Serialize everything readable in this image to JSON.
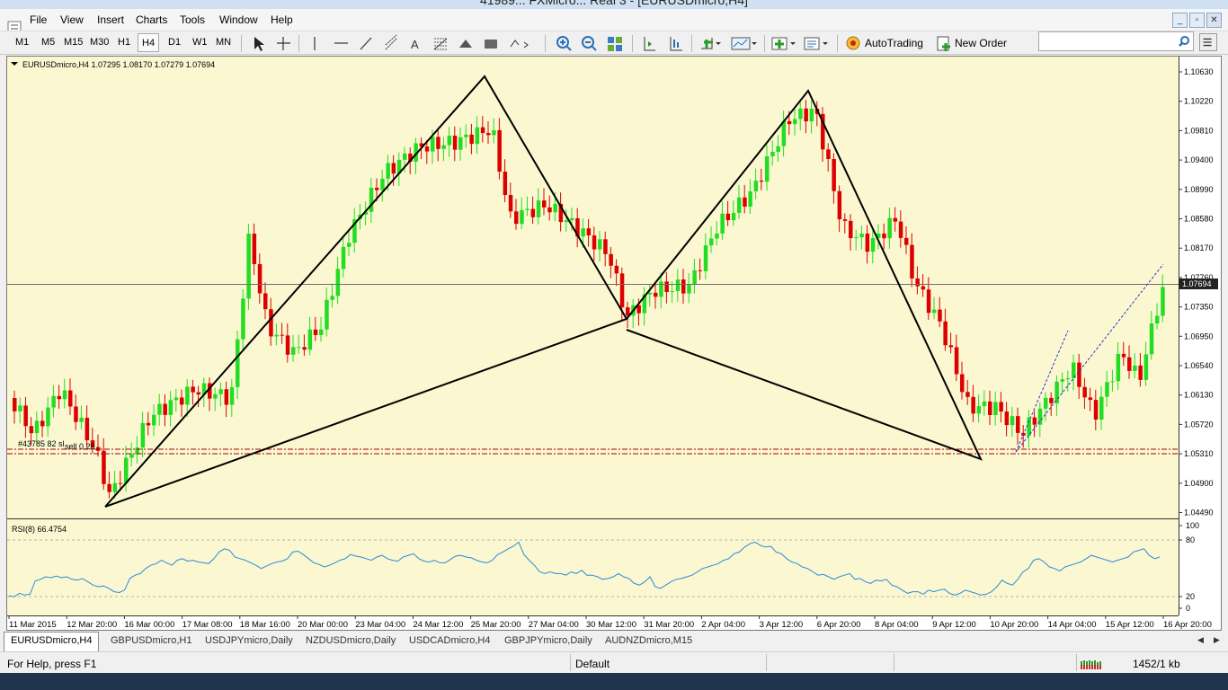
{
  "window": {
    "title": "41989... FXMicro... Real 3 - [EURUSDmicro,H4]"
  },
  "menu": {
    "items": [
      "File",
      "View",
      "Insert",
      "Charts",
      "Tools",
      "Window",
      "Help"
    ]
  },
  "toolbar": {
    "timeframes": [
      "M1",
      "M5",
      "M15",
      "M30",
      "H1",
      "H4",
      "D1",
      "W1",
      "MN"
    ],
    "active_timeframe": "H4",
    "autotrading_label": "AutoTrading",
    "new_order_label": "New Order",
    "search_placeholder": ""
  },
  "chart": {
    "header": "EURUSDmicro,H4  1.07295 1.08170 1.07279 1.07694",
    "current_price_label": "1.07694",
    "price_labels": [
      "1.10630",
      "1.10220",
      "1.09810",
      "1.09400",
      "1.08990",
      "1.08580",
      "1.08170",
      "1.07760",
      "1.07350",
      "1.06950",
      "1.06540",
      "1.06130",
      "1.05720",
      "1.05310",
      "1.04900",
      "1.04490"
    ],
    "order_label": "#43785 82 sl",
    "order_label_2": "sell 0.26",
    "time_labels": [
      "11 Mar 2015",
      "12 Mar 20:00",
      "16 Mar 00:00",
      "17 Mar 08:00",
      "18 Mar 16:00",
      "20 Mar 00:00",
      "23 Mar 04:00",
      "24 Mar 12:00",
      "25 Mar 20:00",
      "27 Mar 04:00",
      "30 Mar 12:00",
      "31 Mar 20:00",
      "2 Apr 04:00",
      "3 Apr 12:00",
      "6 Apr 20:00",
      "8 Apr 04:00",
      "9 Apr 12:00",
      "10 Apr 20:00",
      "14 Apr 04:00",
      "15 Apr 12:00",
      "16 Apr 20:00"
    ],
    "colors": {
      "background": "#fbf8d1",
      "bull": "#22dd22",
      "bear": "#dd0000",
      "pattern": "#000000",
      "rsi": "#2a8ad8",
      "order_line": "#a40000"
    }
  },
  "rsi": {
    "header": "RSI(8) 66.4754",
    "levels": [
      "100",
      "80",
      "20",
      "0"
    ],
    "values": [
      15,
      14,
      18,
      16,
      17,
      33,
      35,
      38,
      37,
      39,
      37,
      38,
      35,
      34,
      36,
      32,
      28,
      26,
      27,
      24,
      20,
      19,
      22,
      36,
      40,
      42,
      48,
      52,
      54,
      58,
      55,
      52,
      58,
      60,
      57,
      58,
      56,
      55,
      54,
      60,
      68,
      72,
      70,
      62,
      60,
      58,
      55,
      52,
      48,
      51,
      54,
      56,
      57,
      60,
      68,
      69,
      65,
      60,
      55,
      53,
      50,
      52,
      55,
      58,
      60,
      65,
      63,
      62,
      60,
      58,
      62,
      64,
      60,
      58,
      57,
      62,
      64,
      66,
      60,
      57,
      56,
      58,
      55,
      55,
      59,
      63,
      64,
      62,
      61,
      58,
      56,
      55,
      58,
      65,
      68,
      72,
      75,
      80,
      65,
      58,
      52,
      44,
      42,
      44,
      42,
      42,
      40,
      44,
      42,
      46,
      40,
      40,
      38,
      35,
      36,
      38,
      42,
      38,
      36,
      30,
      28,
      32,
      38,
      26,
      24,
      28,
      32,
      35,
      36,
      38,
      40,
      44,
      48,
      50,
      52,
      54,
      58,
      60,
      66,
      68,
      74,
      78,
      80,
      76,
      74,
      75,
      68,
      66,
      60,
      56,
      54,
      50,
      48,
      44,
      40,
      41,
      38,
      35,
      38,
      40,
      42,
      35,
      36,
      32,
      30,
      34,
      33,
      35,
      28,
      26,
      22,
      18,
      20,
      20,
      17,
      22,
      20,
      22,
      23,
      18,
      16,
      18,
      22,
      20,
      18,
      16,
      17,
      20,
      26,
      34,
      30,
      28,
      35,
      44,
      48,
      58,
      60,
      56,
      50,
      48,
      45,
      50,
      52,
      54,
      56,
      60,
      64,
      62,
      60,
      58,
      56,
      58,
      60,
      62,
      68,
      70,
      72,
      64,
      60,
      62
    ],
    "max": 100
  },
  "tabs": [
    "EURUSDmicro,H4",
    "GBPUSDmicro,H1",
    "USDJPYmicro,Daily",
    "NZDUSDmicro,Daily",
    "USDCADmicro,H4",
    "GBPJPYmicro,Daily",
    "AUDNZDmicro,M15"
  ],
  "active_tab": "EURUSDmicro,H4",
  "status": {
    "help": "For Help, press F1",
    "profile": "Default",
    "traffic": "1452/1 kb"
  }
}
